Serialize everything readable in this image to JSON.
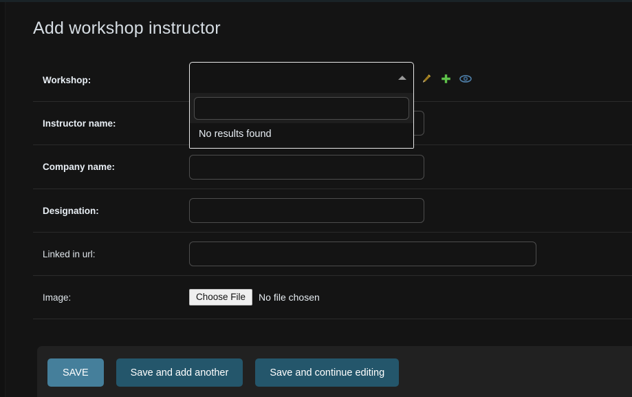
{
  "page": {
    "title": "Add workshop instructor"
  },
  "form": {
    "rows": [
      {
        "label": "Workshop:",
        "required": true,
        "type": "select2"
      },
      {
        "label": "Instructor name:",
        "required": true,
        "type": "text",
        "value": ""
      },
      {
        "label": "Company name:",
        "required": true,
        "type": "text",
        "value": ""
      },
      {
        "label": "Designation:",
        "required": true,
        "type": "text",
        "value": ""
      },
      {
        "label": "Linked in url:",
        "required": false,
        "type": "text",
        "value": ""
      },
      {
        "label": "Image:",
        "required": false,
        "type": "file"
      }
    ]
  },
  "workshop_select": {
    "selected_text": "",
    "state": "open",
    "search_value": "",
    "search_placeholder": "",
    "no_results_text": "No results found",
    "arrow_icon": "chevron-up-icon"
  },
  "related_actions": {
    "change_icon": "pencil-icon",
    "add_icon": "plus-icon",
    "view_icon": "eye-icon",
    "change_color": "#9c7a1f",
    "add_color": "#5ec24a",
    "view_color": "#4f7fa8"
  },
  "image_field": {
    "button_label": "Choose File",
    "status_text": "No file chosen"
  },
  "submit_row": {
    "save_label": "SAVE",
    "save_add_another_label": "Save and add another",
    "save_continue_label": "Save and continue editing"
  },
  "theme": {
    "background": "#141414",
    "panel": "#212121",
    "text": "#e8eef4",
    "title": "#d6dde3",
    "border": "#2b2b2b",
    "input_border": "#4d4d4d",
    "save_button": "#457f9b",
    "secondary_button": "#24566b"
  }
}
